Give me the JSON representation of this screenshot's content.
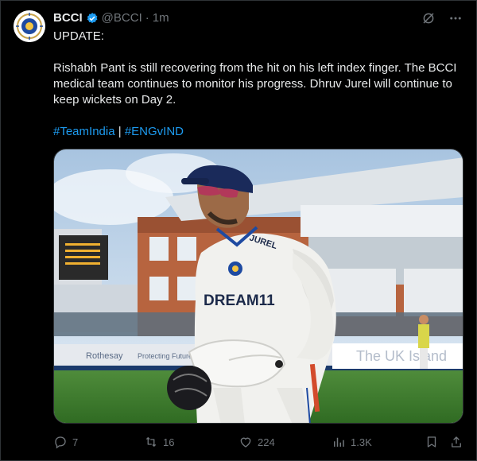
{
  "post": {
    "author_name": "BCCI",
    "handle": "@BCCI",
    "dot": "·",
    "time": "1m",
    "update_line": "UPDATE:",
    "body": "Rishabh Pant is still recovering from the hit on his left index finger. The BCCI medical team continues to monitor his progress. Dhruv Jurel will continue to keep wickets on Day 2.",
    "hashtags": [
      "#TeamIndia",
      "#ENGvIND"
    ],
    "hashtag_separator": "|",
    "media": {
      "jersey_sponsor": "DREAM11",
      "back_text": "JUREL",
      "boards": [
        "Rothesay",
        "Protecting Futures",
        "The UK Island"
      ]
    }
  },
  "actions": {
    "replies": "7",
    "reposts": "16",
    "likes": "224",
    "views": "1.3K"
  },
  "colors": {
    "accent": "#1d9bf0",
    "muted": "#71767b",
    "text": "#e7e9ea",
    "background": "#000000"
  },
  "icons": {
    "top": [
      "grok-icon",
      "more-icon"
    ],
    "actions": [
      "reply-icon",
      "repost-icon",
      "like-icon",
      "views-icon",
      "bookmark-icon",
      "share-icon"
    ]
  }
}
